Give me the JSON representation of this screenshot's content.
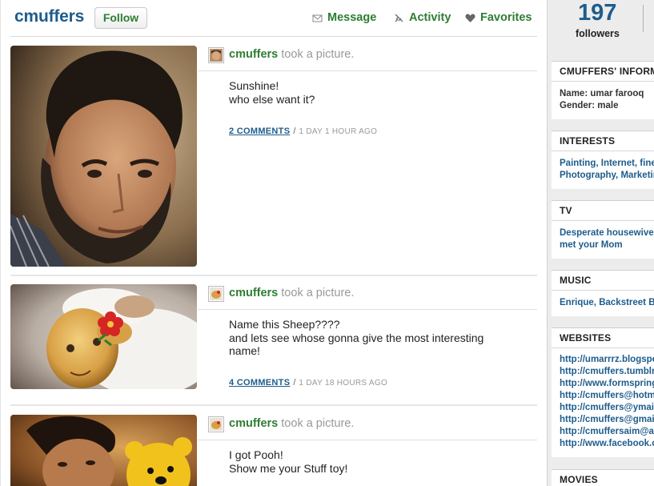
{
  "header": {
    "username": "cmuffers",
    "follow_label": "Follow",
    "message_label": "Message",
    "activity_label": "Activity",
    "favorites_label": "Favorites",
    "icons": [
      "envelope-icon",
      "activity-icon",
      "heart-icon"
    ]
  },
  "posts": [
    {
      "author": "cmuffers",
      "action": "took a picture.",
      "text_lines": [
        "Sunshine!",
        "who else want it?"
      ],
      "comments_label": "2 COMMENTS",
      "separator": "/",
      "time": "1 DAY 1 HOUR AGO"
    },
    {
      "author": "cmuffers",
      "action": "took a picture.",
      "text_lines": [
        "Name this Sheep????",
        "and lets see whose gonna give the most interesting",
        "name!"
      ],
      "comments_label": "4 COMMENTS",
      "separator": "/",
      "time": "1 DAY 18 HOURS AGO"
    },
    {
      "author": "cmuffers",
      "action": "took a picture.",
      "text_lines": [
        "I got Pooh!",
        "Show me your Stuff toy!"
      ]
    }
  ],
  "sidebar": {
    "followers_count": "197",
    "followers_label": "followers",
    "info": {
      "title": "CMUFFERS' INFORMATION",
      "name_line": "Name: umar farooq",
      "gender_line": "Gender: male"
    },
    "interests": {
      "title": "INTERESTS",
      "lines": [
        "Painting, Internet, fine arts",
        "Photography, Marketing"
      ]
    },
    "tv": {
      "title": "TV",
      "lines": [
        "Desperate housewives, How I",
        "met your Mom"
      ]
    },
    "music": {
      "title": "MUSIC",
      "lines": [
        "Enrique, Backstreet Boys"
      ]
    },
    "websites": {
      "title": "WEBSITES",
      "links": [
        "http://umarrrz.blogspot.com",
        "http://cmuffers.tumblr.com",
        "http://www.formspring.me",
        "http://cmuffers@hotmail.com",
        "http://cmuffers@ymail.com",
        "http://cmuffers@gmail.com",
        "http://cmuffersaim@aol.com",
        "http://www.facebook.com"
      ]
    },
    "movies": {
      "title": "MOVIES"
    }
  },
  "colors": {
    "brand_blue": "#1e5c8c",
    "green": "#2e7d32",
    "muted": "#999999"
  }
}
